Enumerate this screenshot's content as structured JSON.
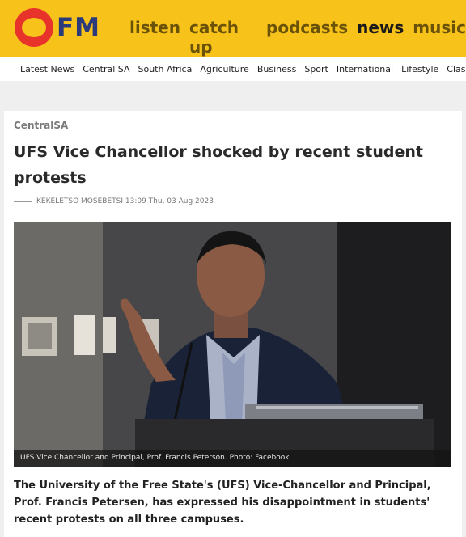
{
  "brand": {
    "logo_text": "FM"
  },
  "main_nav": [
    "listen",
    "catch up",
    "podcasts",
    "news",
    "music"
  ],
  "main_nav_active": "news",
  "sub_nav": [
    "Latest News",
    "Central SA",
    "South Africa",
    "Agriculture",
    "Business",
    "Sport",
    "International",
    "Lifestyle",
    "Classifieds"
  ],
  "article": {
    "category": "CentralSA",
    "headline": "UFS Vice Chancellor shocked by recent student protests",
    "byline": "KEKELETSO MOSEBETSI 13:09 Thu, 03 Aug 2023",
    "photo_caption": "UFS Vice Chancellor and Principal, Prof. Francis Peterson. Photo: Facebook",
    "lead": "The University of the Free State's (UFS) Vice-Chancellor and Principal, Prof. Francis Petersen, has expressed his disappointment in students' recent protests on all three campuses."
  },
  "colors": {
    "header_bg": "#f7c21a",
    "logo_red": "#e8332a",
    "logo_blue": "#2a3a7a",
    "nav_text": "#6a5208"
  }
}
